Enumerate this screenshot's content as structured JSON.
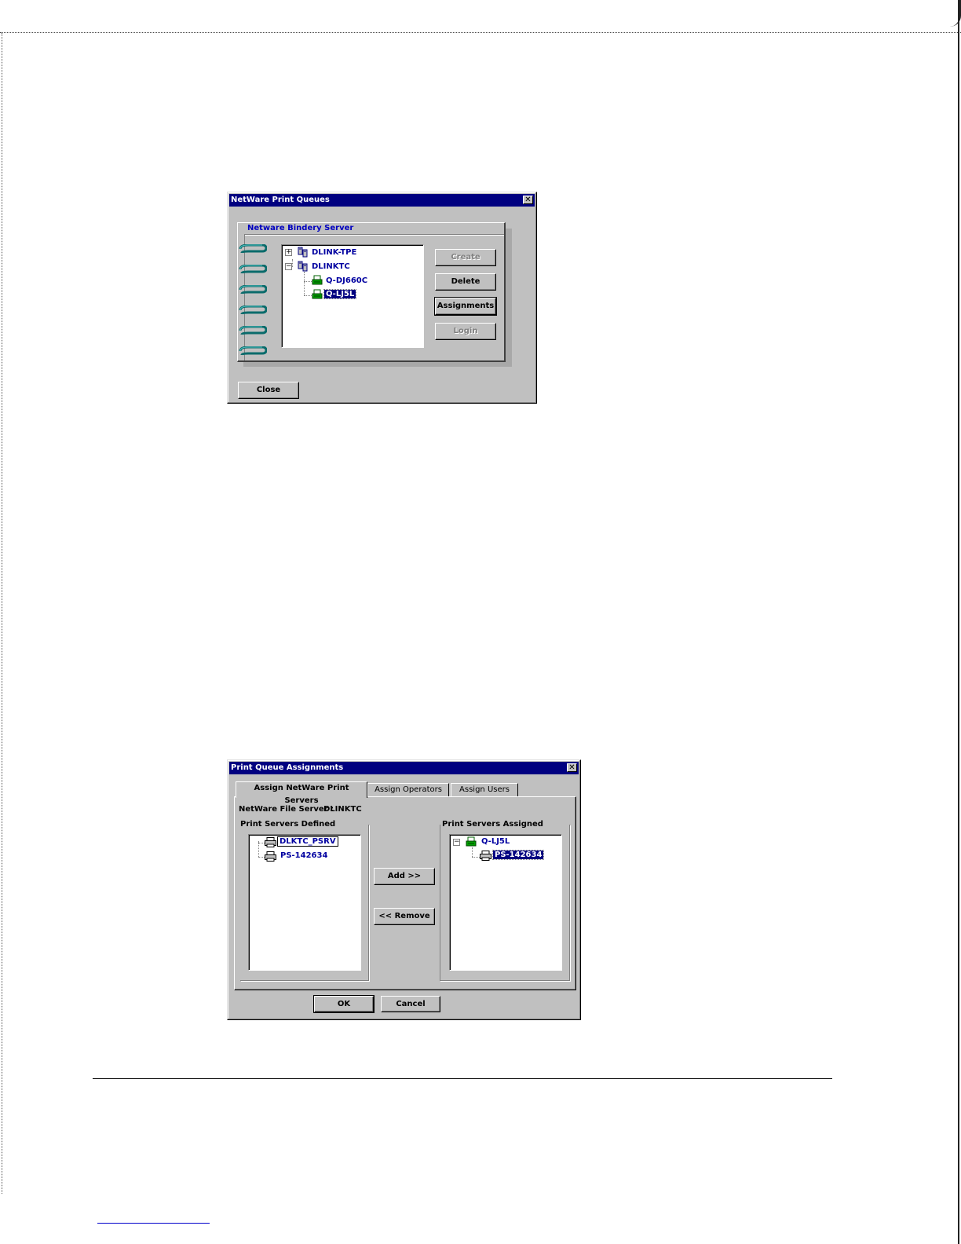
{
  "dialog1": {
    "title": "NetWare Print Queues",
    "close_glyph": "✕",
    "panel_title": "Netware Bindery Server",
    "tree": [
      {
        "label": "DLINK-TPE",
        "expander": "+"
      },
      {
        "label": "DLINKTC",
        "expander": "−"
      },
      {
        "label": "Q-DJ660C"
      },
      {
        "label": "Q-LJ5L"
      }
    ],
    "buttons": {
      "create": "Create",
      "delete": "Delete",
      "assignments": "Assignments",
      "login": "Login",
      "close": "Close"
    }
  },
  "dialog2": {
    "title": "Print Queue Assignments",
    "close_glyph": "✕",
    "tabs": [
      "Assign NetWare Print Servers",
      "Assign Operators",
      "Assign Users"
    ],
    "file_server_label": "NetWare File Server :",
    "file_server_value": "DLINKTC",
    "defined_header": "Print Servers Defined",
    "assigned_header": "Print Servers Assigned",
    "defined_items": [
      "DLKTC_PSRV",
      "PS-142634"
    ],
    "assigned_queue": "Q-LJ5L",
    "assigned_items": [
      "PS-142634"
    ],
    "buttons": {
      "add": "Add >>",
      "remove": "<< Remove",
      "ok": "OK",
      "cancel": "Cancel"
    }
  }
}
